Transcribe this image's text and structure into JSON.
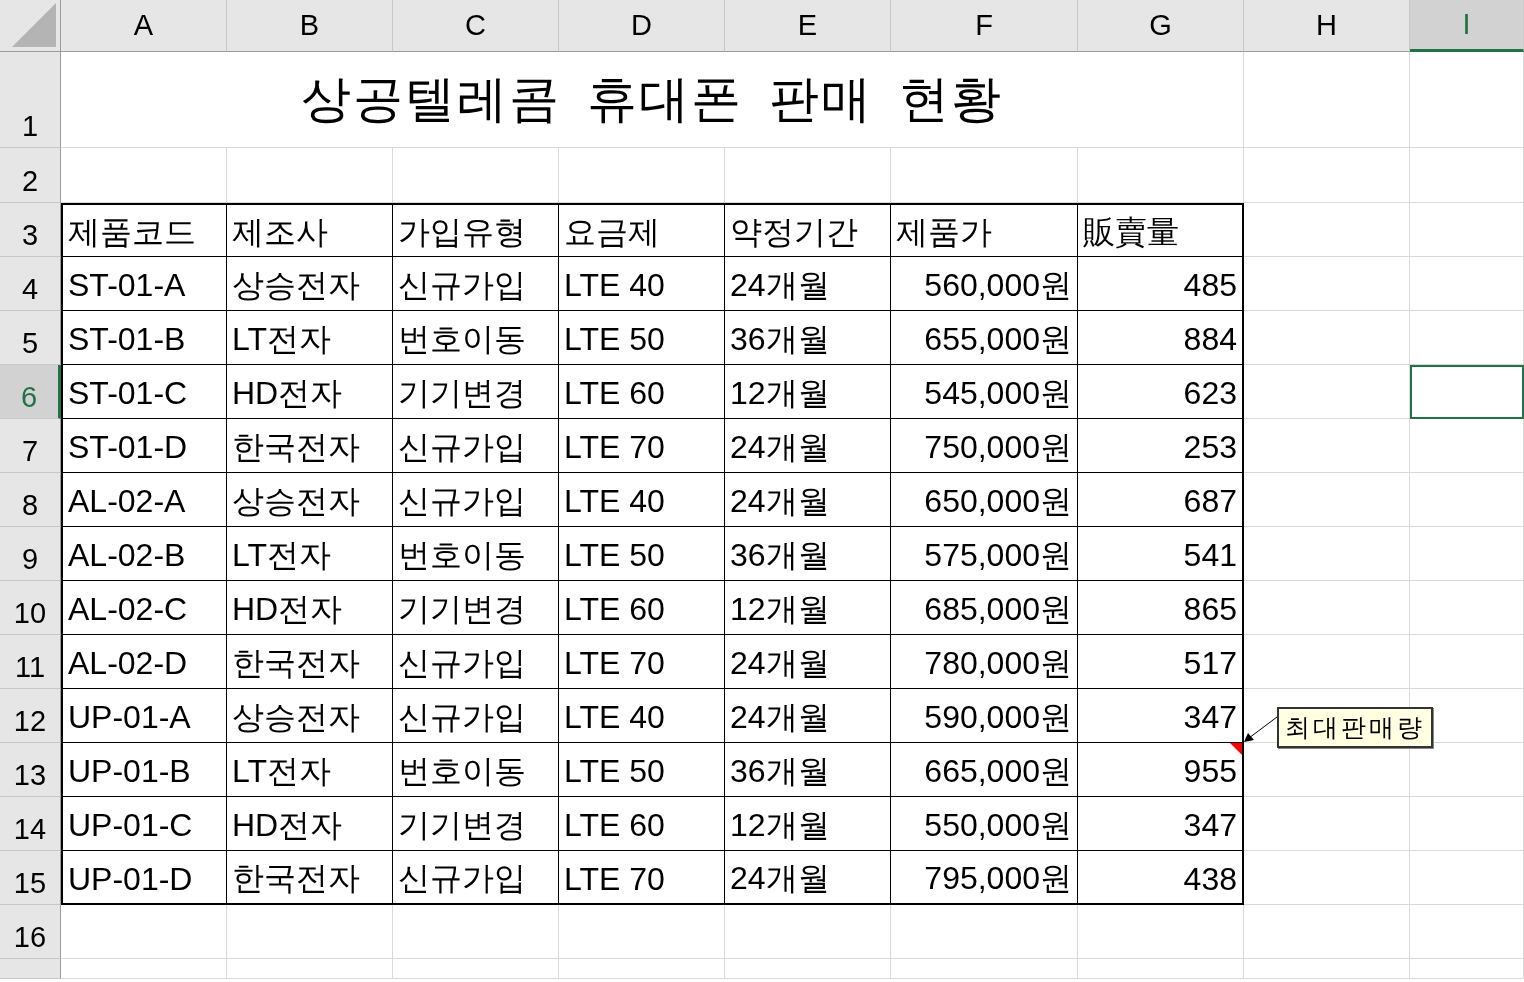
{
  "title": "상공텔레콤 휴대폰 판매 현황",
  "columns": [
    {
      "label": "A",
      "selected": false
    },
    {
      "label": "B",
      "selected": false
    },
    {
      "label": "C",
      "selected": false
    },
    {
      "label": "D",
      "selected": false
    },
    {
      "label": "E",
      "selected": false
    },
    {
      "label": "F",
      "selected": false
    },
    {
      "label": "G",
      "selected": false
    },
    {
      "label": "H",
      "selected": false
    },
    {
      "label": "I",
      "selected": true
    }
  ],
  "rows": [
    {
      "label": "1",
      "selected": false
    },
    {
      "label": "2",
      "selected": false
    },
    {
      "label": "3",
      "selected": false
    },
    {
      "label": "4",
      "selected": false
    },
    {
      "label": "5",
      "selected": false
    },
    {
      "label": "6",
      "selected": true
    },
    {
      "label": "7",
      "selected": false
    },
    {
      "label": "8",
      "selected": false
    },
    {
      "label": "9",
      "selected": false
    },
    {
      "label": "10",
      "selected": false
    },
    {
      "label": "11",
      "selected": false
    },
    {
      "label": "12",
      "selected": false
    },
    {
      "label": "13",
      "selected": false
    },
    {
      "label": "14",
      "selected": false
    },
    {
      "label": "15",
      "selected": false
    },
    {
      "label": "16",
      "selected": false
    }
  ],
  "table": {
    "header": [
      "제품코드",
      "제조사",
      "가입유형",
      "요금제",
      "약정기간",
      "제품가",
      "販賣量"
    ],
    "rows": [
      {
        "cells": [
          "ST-01-A",
          "상승전자",
          "신규가입",
          "LTE 40",
          "24개월",
          "560,000원",
          "485"
        ]
      },
      {
        "cells": [
          "ST-01-B",
          "LT전자",
          "번호이동",
          "LTE 50",
          "36개월",
          "655,000원",
          "884"
        ]
      },
      {
        "cells": [
          "ST-01-C",
          "HD전자",
          "기기변경",
          "LTE 60",
          "12개월",
          "545,000원",
          "623"
        ]
      },
      {
        "cells": [
          "ST-01-D",
          "한국전자",
          "신규가입",
          "LTE 70",
          "24개월",
          "750,000원",
          "253"
        ]
      },
      {
        "cells": [
          "AL-02-A",
          "상승전자",
          "신규가입",
          "LTE 40",
          "24개월",
          "650,000원",
          "687"
        ]
      },
      {
        "cells": [
          "AL-02-B",
          "LT전자",
          "번호이동",
          "LTE 50",
          "36개월",
          "575,000원",
          "541"
        ]
      },
      {
        "cells": [
          "AL-02-C",
          "HD전자",
          "기기변경",
          "LTE 60",
          "12개월",
          "685,000원",
          "865"
        ]
      },
      {
        "cells": [
          "AL-02-D",
          "한국전자",
          "신규가입",
          "LTE 70",
          "24개월",
          "780,000원",
          "517"
        ]
      },
      {
        "cells": [
          "UP-01-A",
          "상승전자",
          "신규가입",
          "LTE 40",
          "24개월",
          "590,000원",
          "347"
        ]
      },
      {
        "cells": [
          "UP-01-B",
          "LT전자",
          "번호이동",
          "LTE 50",
          "36개월",
          "665,000원",
          "955"
        ],
        "comment": "최대판매량"
      },
      {
        "cells": [
          "UP-01-C",
          "HD전자",
          "기기변경",
          "LTE 60",
          "12개월",
          "550,000원",
          "347"
        ]
      },
      {
        "cells": [
          "UP-01-D",
          "한국전자",
          "신규가입",
          "LTE 70",
          "24개월",
          "795,000원",
          "438"
        ]
      }
    ]
  }
}
